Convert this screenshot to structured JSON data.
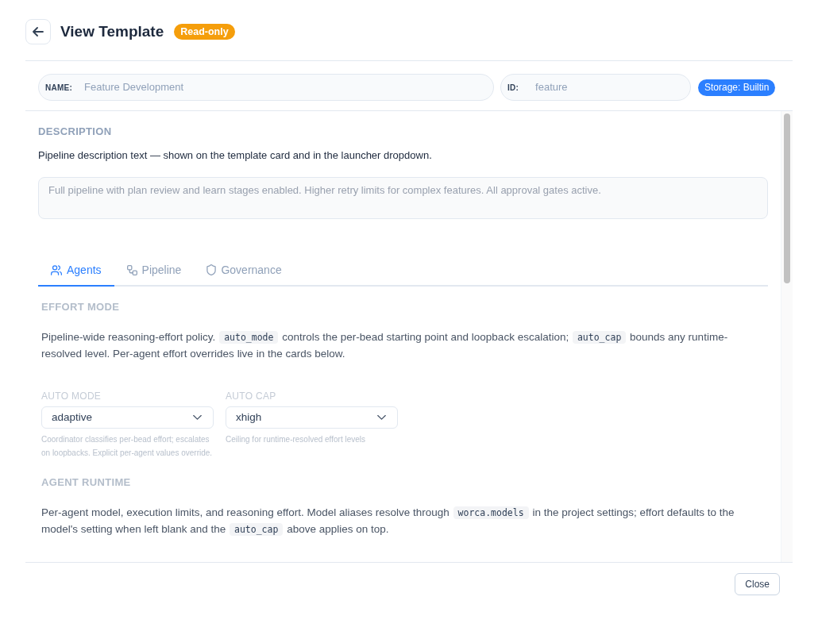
{
  "header": {
    "title": "View Template",
    "badge": "Read-only"
  },
  "identity": {
    "fields": [
      {
        "label": "NAME:",
        "value": "Feature Development"
      },
      {
        "label": "ID:",
        "value": "feature"
      }
    ],
    "storage": "Storage: Builtin"
  },
  "description": {
    "heading": "DESCRIPTION",
    "help": "Pipeline description text — shown on the template card and in the launcher dropdown.",
    "value": "Full pipeline with plan review and learn stages enabled. Higher retry limits for complex features. All approval gates active."
  },
  "tabs": [
    {
      "label": "Agents",
      "kind": "people",
      "selected": true
    },
    {
      "label": "Pipeline",
      "kind": "flow",
      "selected": false
    },
    {
      "label": "Governance",
      "kind": "shield",
      "selected": false
    }
  ],
  "sections": [
    {
      "heading": "EFFORT MODE",
      "paragraph": [
        {
          "kind": "text",
          "text": "Pipeline-wide reasoning-effort policy. "
        },
        {
          "kind": "code",
          "text": "auto_mode"
        },
        {
          "kind": "text",
          "text": " controls the per-bead starting point and loopback escalation; "
        },
        {
          "kind": "code",
          "text": "auto_cap"
        },
        {
          "kind": "text",
          "text": " bounds any runtime-resolved level. Per-agent effort overrides live in the cards below."
        }
      ],
      "selects": [
        {
          "label": "AUTO MODE",
          "value": "adaptive",
          "hint": "Coordinator classifies per-bead effort; escalates on loopbacks. Explicit per-agent values override."
        },
        {
          "label": "AUTO CAP",
          "value": "xhigh",
          "hint": "Ceiling for runtime-resolved effort levels"
        }
      ]
    },
    {
      "heading": "AGENT RUNTIME",
      "paragraph": [
        {
          "kind": "text",
          "text": "Per-agent model, execution limits, and reasoning effort. Model aliases resolve through "
        },
        {
          "kind": "code",
          "text": "worca.models"
        },
        {
          "kind": "text",
          "text": " in the project settings; effort defaults to the model's setting when left blank and the "
        },
        {
          "kind": "code",
          "text": "auto_cap"
        },
        {
          "kind": "text",
          "text": " above applies on top."
        }
      ]
    }
  ],
  "footer": {
    "close": "Close"
  }
}
